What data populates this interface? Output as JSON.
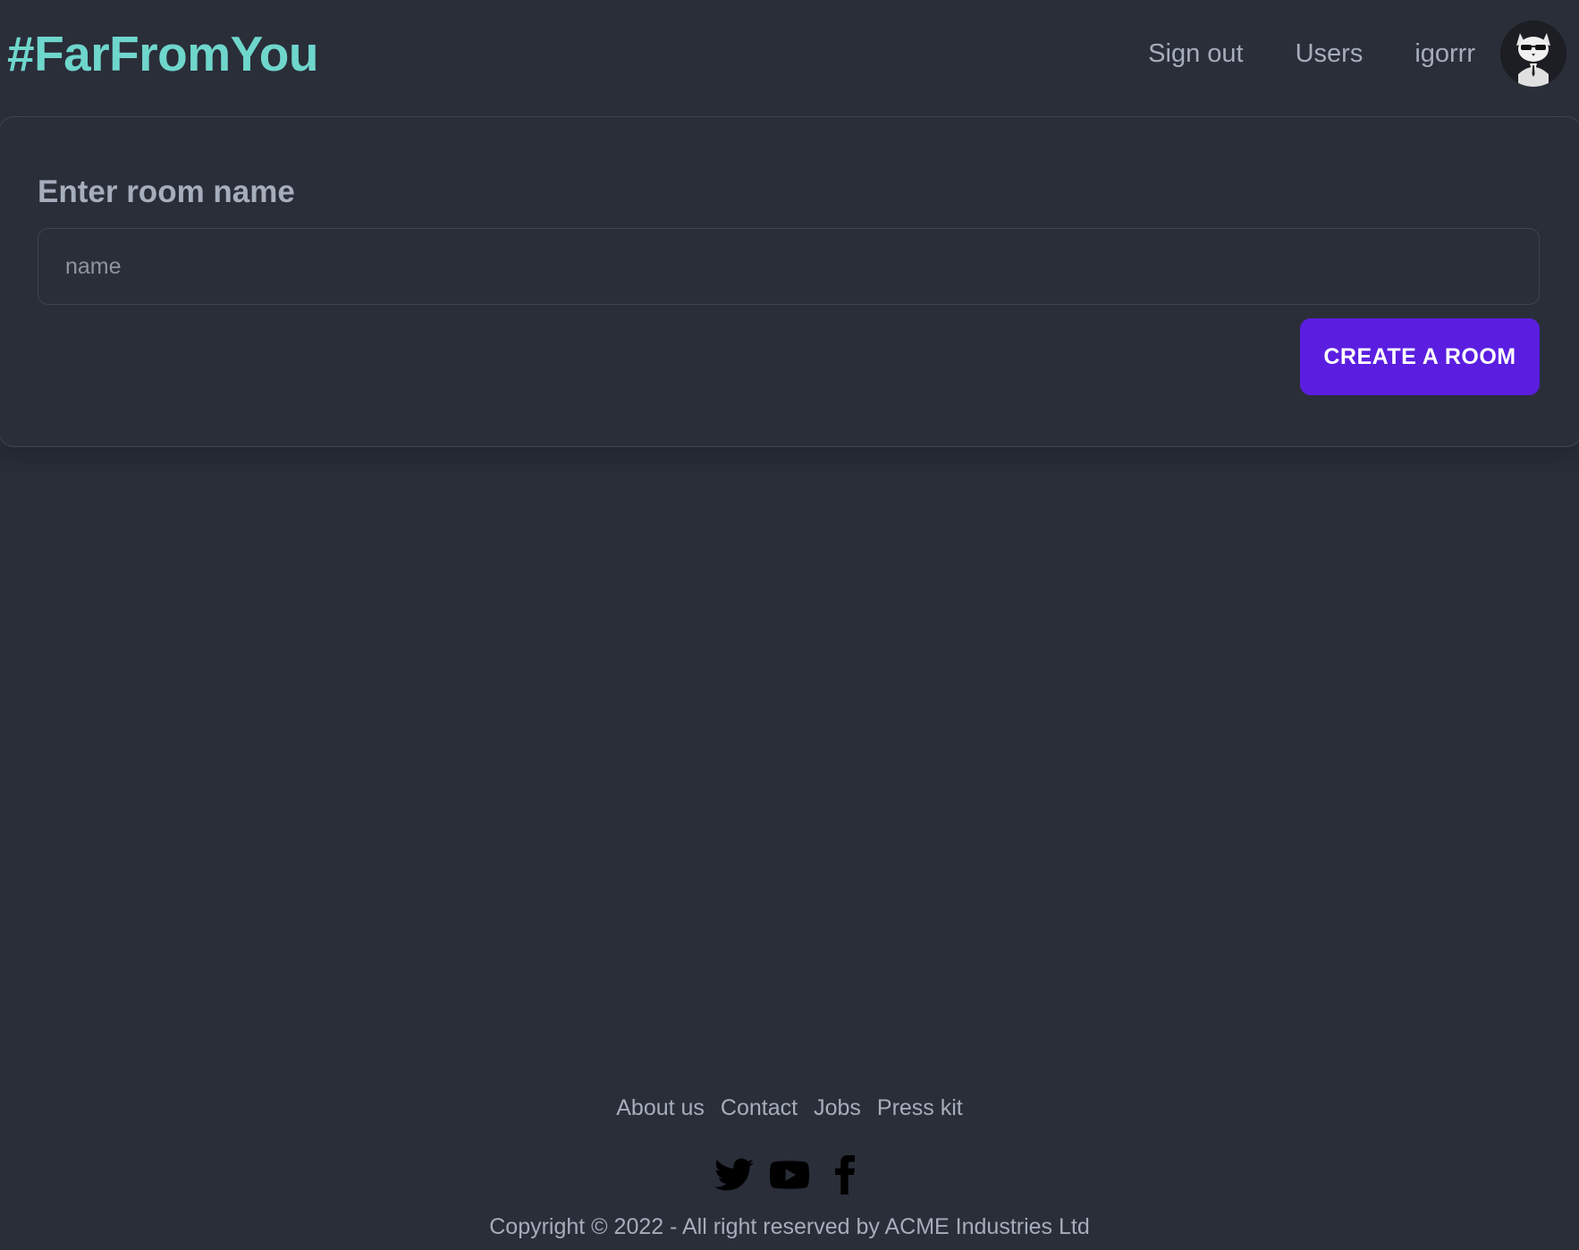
{
  "header": {
    "brand": "#FarFromYou",
    "nav": {
      "sign_out": "Sign out",
      "users": "Users",
      "username": "igorrr"
    },
    "avatar_icon": "cat-in-suit-avatar"
  },
  "room_form": {
    "title": "Enter room name",
    "input_placeholder": "name",
    "input_value": "",
    "submit_label": "CREATE A ROOM"
  },
  "footer": {
    "links": [
      "About us",
      "Contact",
      "Jobs",
      "Press kit"
    ],
    "social_icons": [
      "twitter-icon",
      "youtube-icon",
      "facebook-icon"
    ],
    "copyright": "Copyright © 2022 - All right reserved by ACME Industries Ltd"
  },
  "colors": {
    "background": "#2a2e39",
    "brand": "#6fd6cc",
    "text_muted": "#a6adbb",
    "primary_button": "#5b1ee0",
    "border": "#3f4450"
  }
}
